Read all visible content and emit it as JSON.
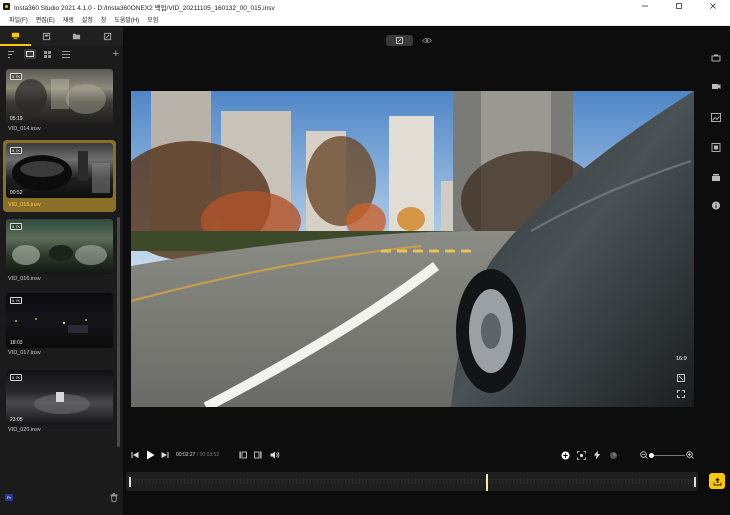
{
  "window": {
    "title": "Insta360 Studio 2021 4.1.0 - D:/Insta360ONEX2 백업/VID_20211105_160132_00_015.insv",
    "controls": [
      "minimize",
      "maximize",
      "close"
    ]
  },
  "menu": [
    "파일(F)",
    "편집(E)",
    "재생",
    "설정",
    "창",
    "도움말(H)",
    "모험"
  ],
  "left_panel": {
    "tabs": [
      {
        "icon": "media-library-icon",
        "active": true
      },
      {
        "icon": "album-icon",
        "active": false
      },
      {
        "icon": "folder-icon",
        "active": false
      },
      {
        "icon": "edit-project-icon",
        "active": false
      }
    ],
    "view_modes": [
      "sort-list-icon",
      "large-thumbnail-icon",
      "grid-icon",
      "list-icon"
    ],
    "add_label": "+",
    "clips": [
      {
        "name": "VID_014.insv",
        "duration": "05:19",
        "badge": "5.7K",
        "selected": false
      },
      {
        "name": "VID_015.insv",
        "duration": "00:52",
        "badge": "5.7K",
        "selected": true
      },
      {
        "name": "VID_016.insv",
        "duration": "",
        "badge": "5.7K",
        "selected": false
      },
      {
        "name": "VID_017.insv",
        "duration": "18:03",
        "badge": "5.7K",
        "selected": false
      },
      {
        "name": "VID_020.insv",
        "duration": "23:05",
        "badge": "5.7K",
        "selected": false
      }
    ],
    "bottom_badge": "Pr"
  },
  "viewer": {
    "aspect_ratio": "16:9"
  },
  "playback": {
    "current_time": "00:02:27",
    "total_time": "00:03:52",
    "zoom_level": 0.1
  },
  "colors": {
    "accent": "#ffc800",
    "background": "#0d0d0d",
    "panel": "#1b1b1b"
  }
}
